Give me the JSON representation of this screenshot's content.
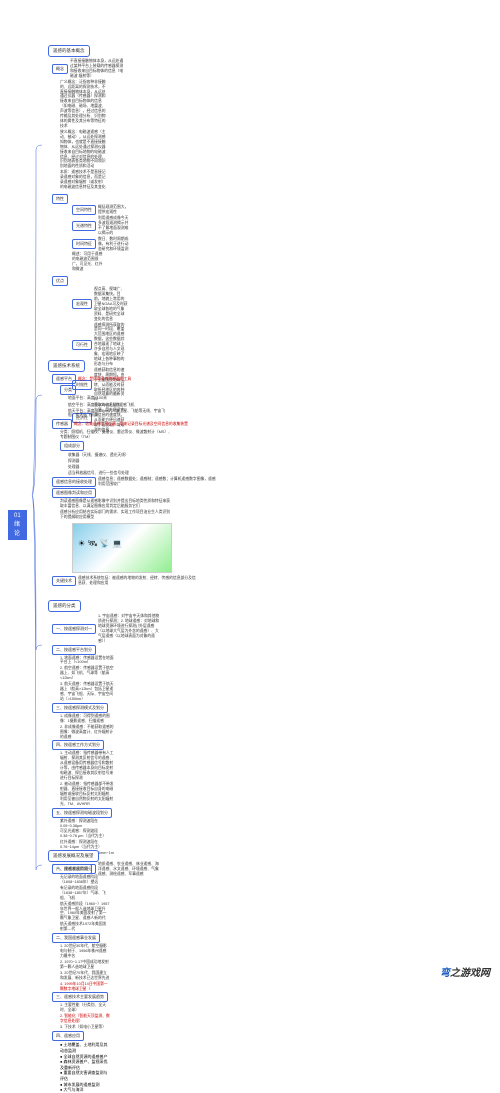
{
  "root": "01绪论",
  "footer": "弯之游戏网",
  "branches": {
    "b1": {
      "title": "遥感的基本概念",
      "items": {
        "def_label": "概念",
        "def_text": "不直接接触物体本身，从远处通过某种平台上装载的传感器探测和接收来自目标物体的信息（电磁波 辐射等）",
        "broad_text": "广义概念：泛指各种非接触的、远距离的探测技术，不直接接触物体本身，从远处通过仪器（传感器）探测和接收来自目标物体的信息（如电磁、磁场、地震波、声波等信息），经过信息的传输及其处理分析、识别物体的属性及其分布等特征的技术",
        "narrow_text": "狭义概念：电磁波遥感（主动、被动），从远处探测感知物体，也就是不直接接触物体、从远处通过探测仪器接收来自目标地物的电磁波信息、经过对信息的处理、识别地表各类地物不同和识别地面的性质和活动",
        "nature_text": "本质：遥感技术不是直接记录遥感对象的信息，而是记录遥感对象辐射（或发射）的电磁波信息特征及其变化",
        "props_label": "特性",
        "p1_label": "空间特性",
        "p1_text": "概括观测范围大，提供宏观性",
        "p2_label": "光谱特性",
        "p2_text": "利用遥感成像今天多波段观测揭示并不了解地面观测难以揭示的",
        "p3_label": "时间特征",
        "p3_text": "数日、数时周期成像，有利于进行动态研究和环境监测",
        "p4_prefix": "概述：可用于遥感的电磁波范围很广，可见光、红外和微波",
        "advantages_label": "优点",
        "a1_label": "宏观性",
        "a1_text": "视点高、视域广、数据采集快。目前，地貌上常用的卫星NOAA可及时获取全球各地的气象资料、是研究全球变化的信息",
        "a2_label": "可行性",
        "a2_text": "遥感探测所获取的是同一时段、覆盖大范围地区的遥感数据，这些数据综合地展现了地球上许多自然与人文现象、宏观地反映了地球上各种事物的形态与分布",
        "a3_label": "时效性",
        "a3_text": "遥感获取信息的速度快、周期短。由于卫星围绕地球运转、从而能及时获取所经地区的各种自然现象的最新资料",
        "a4_label": "经济性",
        "a4_text": "获取的信息量大、方便、简方便适合获信息的速度快。从而能方便迅速获取手段获取广域观测的信息"
      }
    },
    "b2": {
      "title": "遥感技术系统",
      "platform_label": "遥感平台",
      "platform_def": "概念：是搭载遥感传感器的工具",
      "platform_types": "分类",
      "pt1": "地面平台：高度<100米",
      "pt2": "航空平台：高度在100m以上的遥感飞机",
      "pt3": "航天平台：高度>150km的人造卫星、飞船等无线、宇宙飞船、航天际飞机等",
      "sensor_label": "传感器",
      "sensor_def": "概念：收集遥感信息仪器、用来记录目标光谱及空间信息的收集装置",
      "sensor_types": "分类：照相机、扫描仪、摄谱仪、雷达等仪、微波散射计（MS）、专题制图仪（TM）",
      "sensor_comp": "组成部分",
      "sc1": "收集器（天线、摄谱仪、透光天线）",
      "sc2": "探测器",
      "sc3": "处理器",
      "sc4": "适当释放器信号、进行一些信号处理",
      "info_label": "遥感信息的接收处理",
      "info_items": "遥感信息；遥感数据处；遥感制；遥感数；计算机遥感数字图像，遥感利用范围较广",
      "output_label": "遥感图像判读和应用",
      "out1": "判读遥感图像是从遥感影像中识别并提出目标地类性质和特征来获取丰富信息、以满足图像应用判定后能服务它们",
      "out2": "遥感分析应用结合实际部门的需求、实现工作项目油业生人类识别下的提纲取应用模型",
      "key_label": "关键技术",
      "key_text": "遥感技术系统包括：被遥感的地物的发射、经转、传感的信息部分及信息获、处理和应用"
    },
    "b3": {
      "title": "遥感的分类",
      "c1_label": "一、按遥感探测对一",
      "c1_items": "1. 宇宙遥感：对宇宙中天体和其他物质进行探测；2. 地球遥感：对地球和地球资源环境进行探测(（外层遥感（以地球大气层为外含的遥感）、大气层遥感（以地球表面为对象的遥感））",
      "c2_label": "二、按遥感平台划分",
      "c2_1": "1. 地面遥感：传感器设置在地面平台上（<100m）",
      "c2_2": "2. 航空遥感：传感器设置于航空器上、如飞机、气球等（航高<12km）",
      "c2_3": "3. 航天遥感：传感器设置于航天器上（航高>12km）包括卫星遥感、宇宙飞船、天际、宇宙空间站（>150km）",
      "c3_label": "三、按遥感探测模式及划分",
      "c3_1": "1. 成像遥感：可得到遥感的图像：1摄影遥感、扫描遥感",
      "c3_2": "2. 非成像遥感：不能获取遥感的图像：微波高度计、红外辐射计的遥感",
      "c4_label": "四、按遥感工作方式划分",
      "c4_1": "1. 主动遥感：指传感器带有人工辐射、探测其反射信号的遥感、从遥感设备用传感器信号和散射计等，由传感器本身向目标发射电磁波、探后接收其反射信号来进行目标探测",
      "c4_2": "2. 被动遥感：指传感器部不带发射器、直接接收目标自身的电磁辐射或接收目标反射太阳辐射、利用至被自然物反射的太阳辐射光、TM、AVHRR",
      "c5_label": "五、按遥感探测电磁波段划分",
      "c5_1": "紫外遥感：探测波段在0.05~0.38μm",
      "c5_2": "可见光遥感：探测波段0.38~0.76 μm（当代为主）",
      "c5_3": "红外遥感：探测波段在0.76~14μm（当代为主）",
      "c5_4": "微波遥感：探测波段在1mm~1m（新兴）",
      "c6_label": "六、按遥感应用划分",
      "c6_text": "地质遥感、农业遥感、林业遥感、海洋遥感、水文遥感、环境遥感、气象遥感、测绘遥感、军事遥感"
    },
    "b4": {
      "title": "遥感发展概况及展望",
      "s1_label": "一、遥感发展阶段",
      "s1_1": "无记录的地面遥感阶段（1608~1838年）望远",
      "s1_2": "有记录的地面遥感阶段（1838~1857年）气球、飞船、飞机",
      "s1_3": "航天遥感阶段（1960~）1957年世界一般人造地球卫星升空、1960年美国发射了第一颗气象卫星、遥感人新的代",
      "s1_4": "航天遥感技术1972年美国发射第—代",
      "s2_label": "二、我国遥感事业发展",
      "s2_1": "1. 20世纪30年代、航空摄影电与制于、1956年株州遥感力最中名",
      "s2_2": "2. 1970~1.17中国成功地发射第一颗人造地球卫星",
      "s2_3": "3. 20世纪70年代、我国建立和发展、新技术已达世界先进",
      "s2_4": "4. 1999年10月14日中国第一颗数字地球卫星（",
      "s3_label": "三、遥感技术主要发展趋势",
      "s3_1": "1. 主要性能（分类别、全天时、全球）",
      "s3_2": "2. 智能化（智能天顶监测、数字信息处理）",
      "s3_3": "3. 下技术（如电小卫星等）",
      "s4_label": "四、遥感应用",
      "s4_items": [
        "土地覆盖、土地利用及其动态监测",
        "全球自然资源的遥感普产",
        "森林资源普产、监视采伐及重新评估",
        "重要自然灾害调查监测与评估",
        "城市发展的遥感监测",
        "大气与海洋"
      ]
    }
  }
}
